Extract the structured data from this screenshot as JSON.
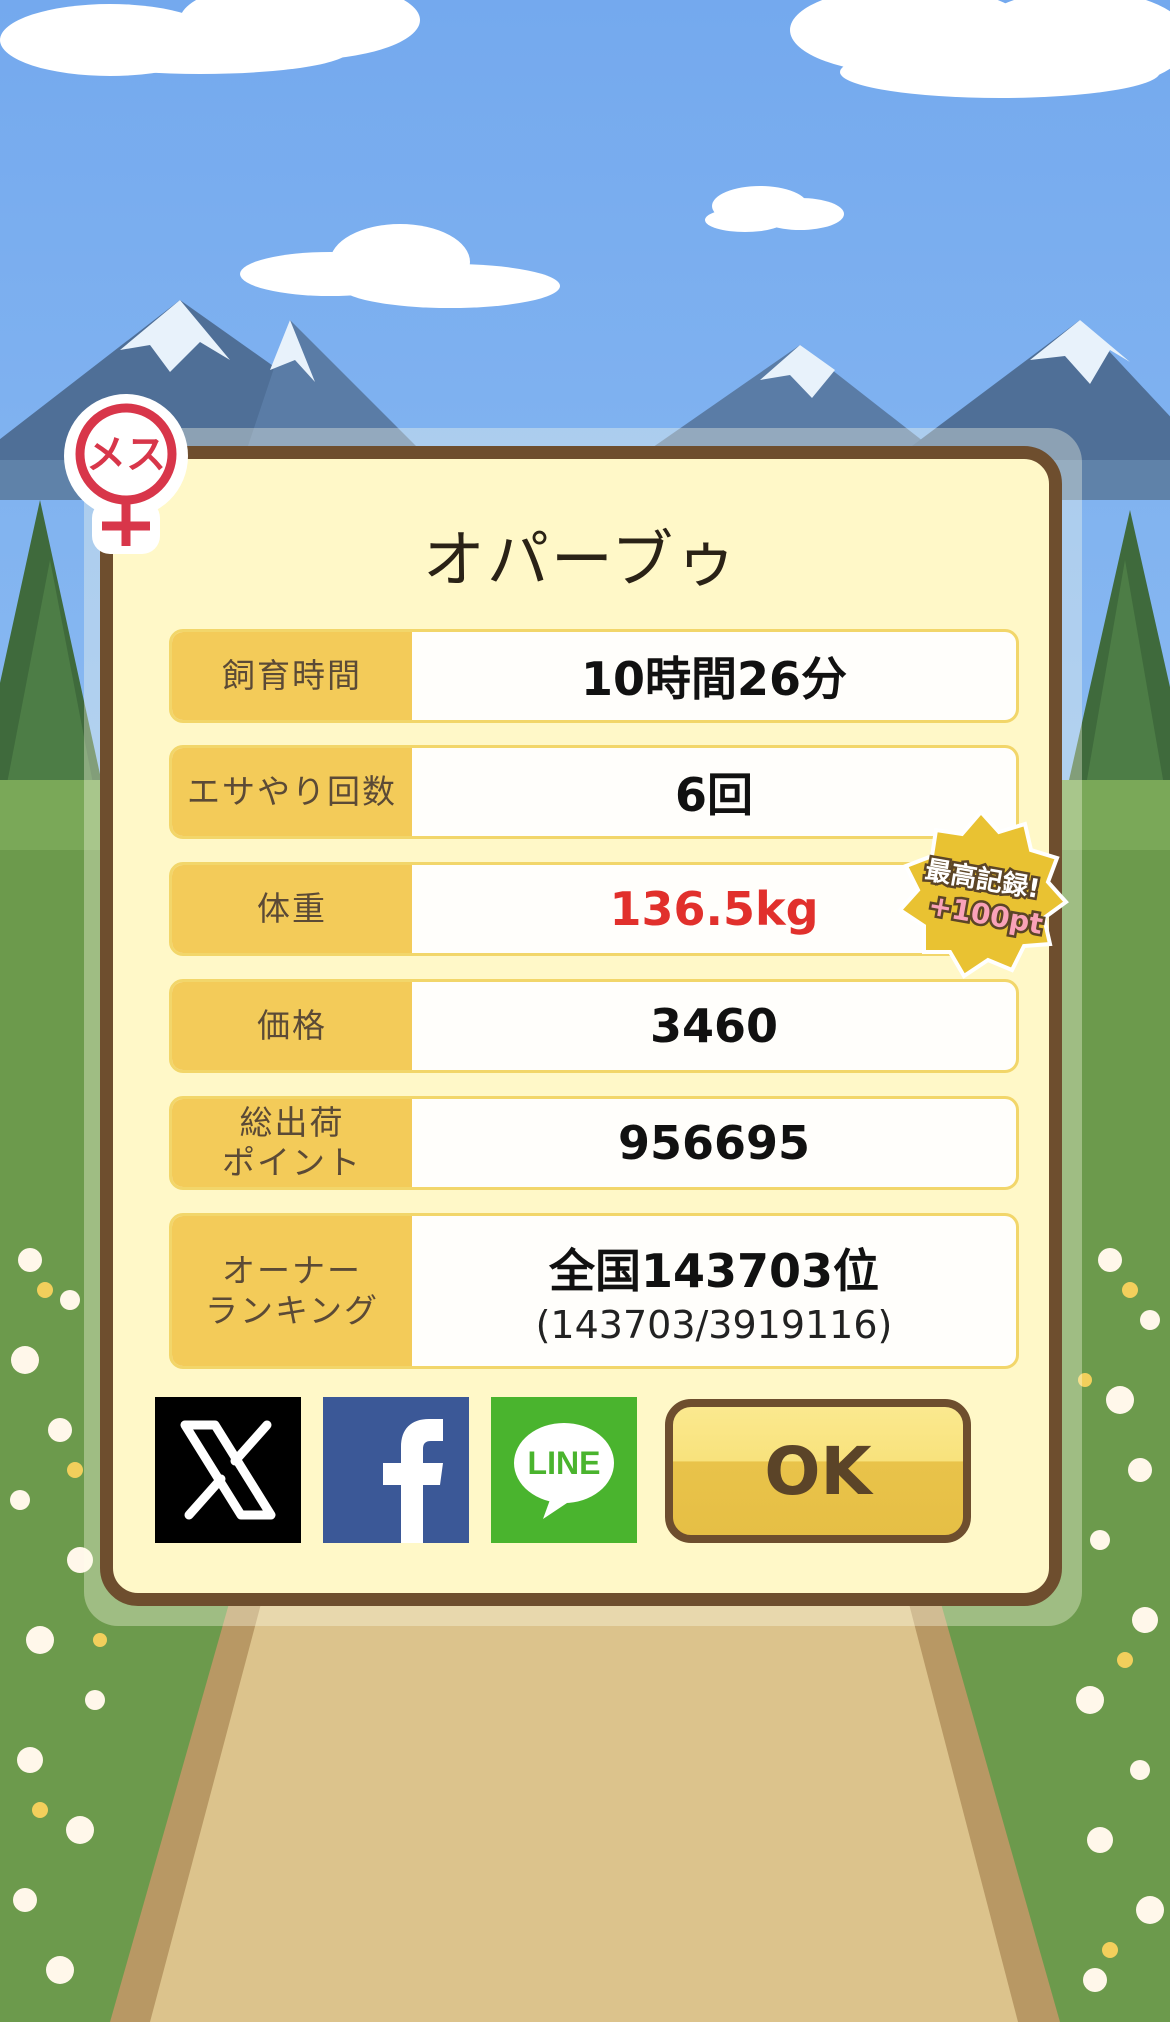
{
  "pig": {
    "name": "オパーブゥ",
    "gender_badge": "メス"
  },
  "stats": [
    {
      "label": "飼育時間",
      "value": "10時間26分"
    },
    {
      "label": "エサやり回数",
      "value": "6回"
    },
    {
      "label": "体重",
      "value": "136.5kg",
      "color": "#e1302c"
    },
    {
      "label": "価格",
      "value": "3460"
    },
    {
      "label": "総出荷\nポイント",
      "value": "956695"
    },
    {
      "label": "オーナー\nランキング",
      "value": "全国143703位",
      "sub": "(143703/3919116)"
    }
  ],
  "record_badge": {
    "line1": "最高記録!",
    "line2": "+100pt"
  },
  "share": {
    "x_icon": "x-logo-icon",
    "facebook_icon": "facebook-logo-icon",
    "line_icon": "line-logo-icon",
    "line_label": "LINE"
  },
  "ok_label": "OK",
  "colors": {
    "dialog_bg": "#fff8c8",
    "dialog_border": "#6e4e2e",
    "label_bg": "#f3cb59",
    "highlight_red": "#e1302c",
    "female_red": "#d8364a"
  }
}
